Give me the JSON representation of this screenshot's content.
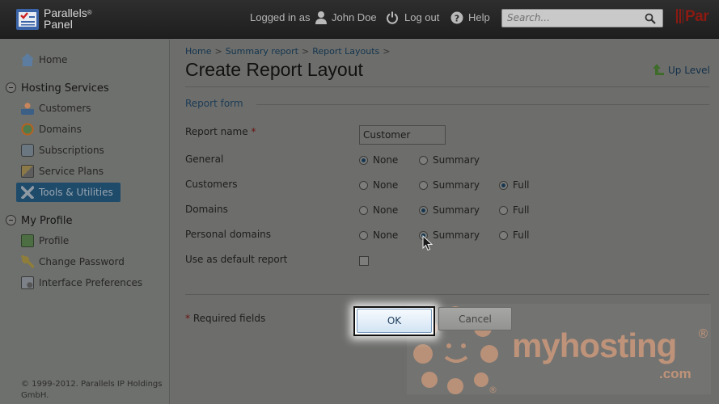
{
  "header": {
    "logo_line1": "Parallels",
    "logo_reg": "®",
    "logo_line2": "Panel",
    "logged_in_prefix": "Logged in as",
    "user_name": "John Doe",
    "logout": "Log out",
    "help": "Help",
    "search_placeholder": "Search...",
    "brand_right": "Par"
  },
  "sidebar": {
    "home": "Home",
    "groups": [
      {
        "label": "Hosting Services",
        "items": [
          "Customers",
          "Domains",
          "Subscriptions",
          "Service Plans",
          "Tools & Utilities"
        ],
        "active": "Tools & Utilities"
      },
      {
        "label": "My Profile",
        "items": [
          "Profile",
          "Change Password",
          "Interface Preferences"
        ]
      }
    ],
    "copyright": "© 1999-2012. Parallels IP Holdings GmbH."
  },
  "main": {
    "breadcrumb": [
      "Home",
      "Summary report",
      "Report Layouts"
    ],
    "breadcrumb_sep": ">",
    "title": "Create Report Layout",
    "up_level": "Up Level",
    "legend": "Report form",
    "fields": {
      "report_name_label": "Report name",
      "required_mark": "*",
      "report_name_value": "Customer",
      "general": "General",
      "customers": "Customers",
      "domains": "Domains",
      "personal_domains": "Personal domains",
      "use_default": "Use as default report"
    },
    "options": {
      "none": "None",
      "summary": "Summary",
      "full": "Full"
    },
    "selected": {
      "general": "None",
      "customers": "Full",
      "domains": "Summary",
      "personal_domains": "Summary"
    },
    "use_default_checked": false,
    "required_note": "Required fields",
    "ok": "OK",
    "cancel": "Cancel"
  },
  "watermark": {
    "text": "myhosting",
    "dotcom": ".com",
    "reg": "®"
  },
  "colors": {
    "active_nav": "#1f4b6b",
    "link": "#13344f",
    "watermark": "#e8a57e"
  }
}
